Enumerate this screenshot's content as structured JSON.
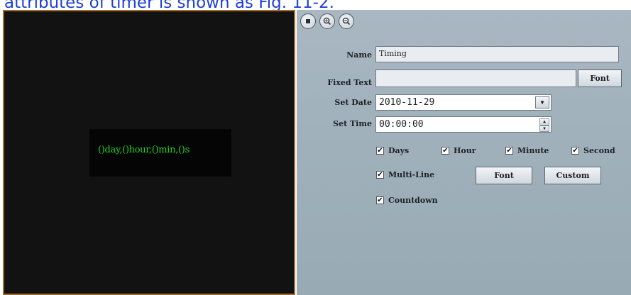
{
  "caption": "attributes of timer is shown as Fig. 11-2.",
  "preview": {
    "led_text": "()day,()hour,()min,()s"
  },
  "toolbar": {
    "icons": [
      "stop-icon",
      "zoom-in-icon",
      "zoom-out-icon"
    ]
  },
  "form": {
    "name_label": "Name",
    "name_value": "Timing",
    "fixed_text_label": "Fixed Text",
    "fixed_text_value": "",
    "font_button": "Font",
    "set_date_label": "Set Date",
    "set_date_value": "2010-11-29",
    "set_time_label": "Set Time",
    "set_time_value": "00:00:00"
  },
  "options": {
    "days": "Days",
    "hour": "Hour",
    "minute": "Minute",
    "second": "Second",
    "multi_line": "Multi-Line",
    "multi_font_button": "Font",
    "custom_button": "Custom",
    "countdown": "Countdown",
    "check_mark": "✔"
  },
  "colors": {
    "led_green": "#1fd21f",
    "panel_bg": "#a9b7c1",
    "preview_border": "#a16a2a"
  }
}
